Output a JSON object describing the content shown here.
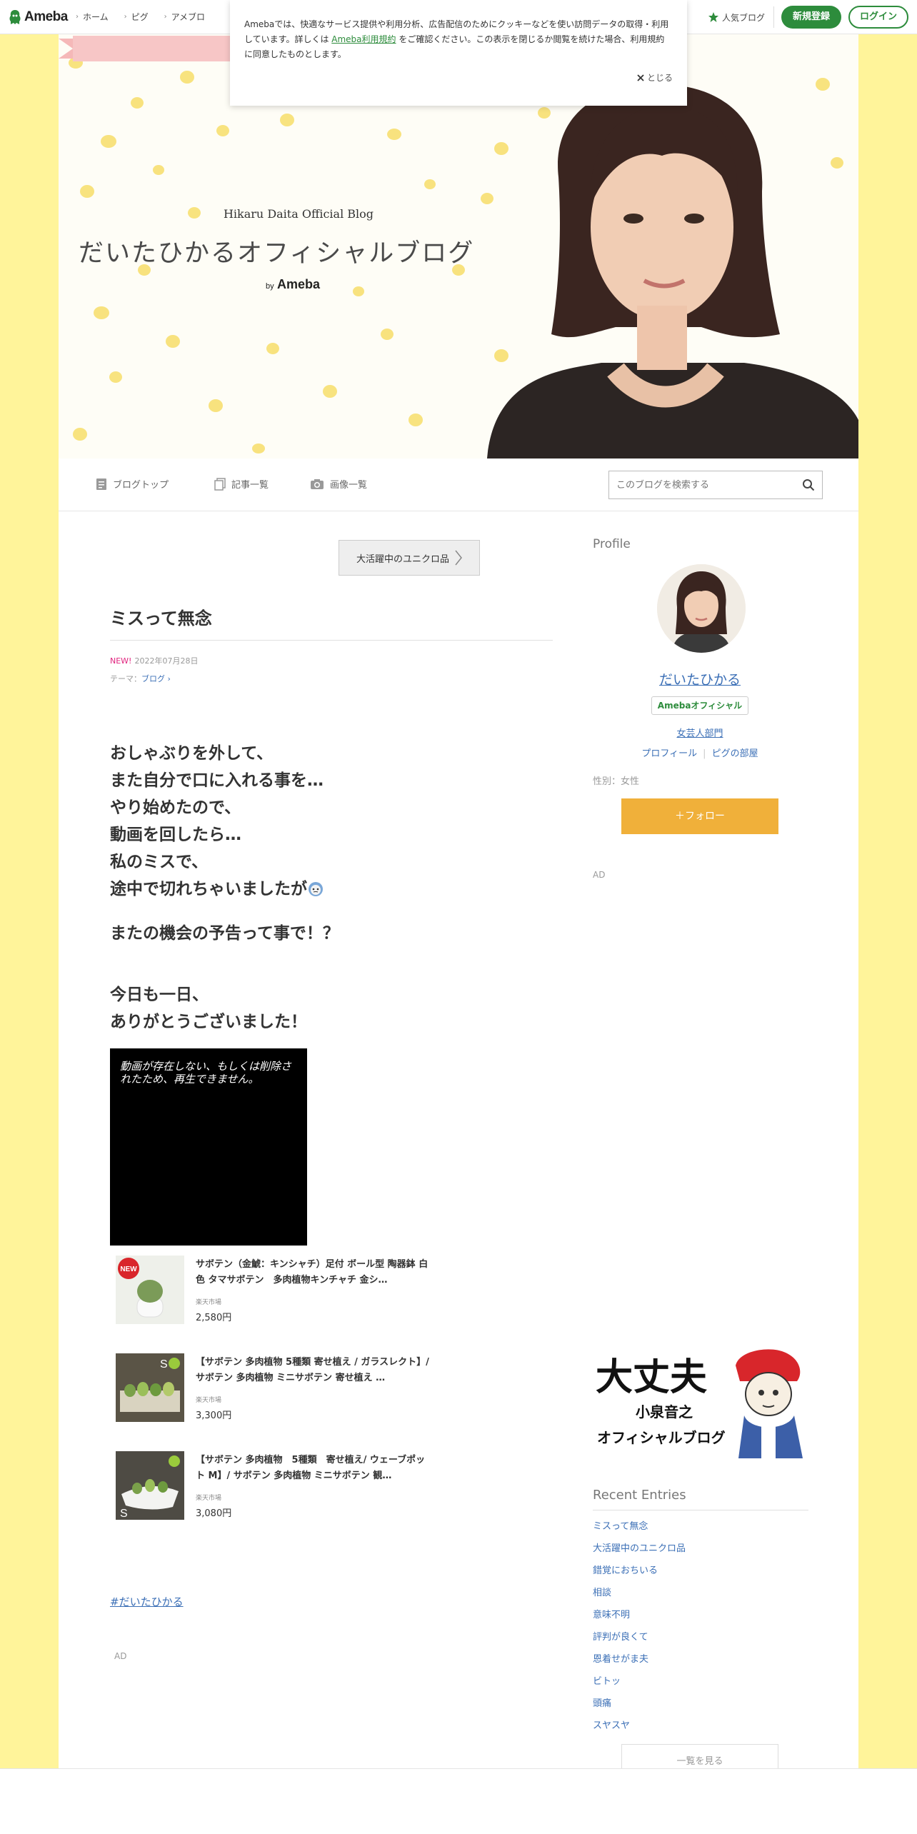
{
  "global_nav": {
    "logo": "Ameba",
    "items": [
      "ホーム",
      "ピグ",
      "アメブロ"
    ],
    "popular_label": "人気ブログ",
    "signup_label": "新規登録",
    "login_label": "ログイン"
  },
  "cookie": {
    "text_before": "Amebaでは、快適なサービス提供や利用分析、広告配信のためにクッキーなどを使い訪問データの取得・利用しています。詳しくは ",
    "link": "Ameba利用規約",
    "text_after": " をご確認ください。この表示を閉じるか閲覧を続けた場合、利用規約に同意したものとします。",
    "close_label": "とじる"
  },
  "header": {
    "ribbon": "Hikaru Daita Official Blog",
    "title": "だいたひかるオフィシャルブログ",
    "by": "by",
    "ameba": "Ameba"
  },
  "blog_nav": {
    "top": "ブログトップ",
    "entries": "記事一覧",
    "images": "画像一覧",
    "search_placeholder": "このブログを検索する"
  },
  "article": {
    "prev_label": "大活躍中のユニクロ品",
    "title": "ミスって無念",
    "new_badge": "NEW!",
    "date": "2022年07月28日",
    "theme_prefix": "テーマ：",
    "theme": "ブログ",
    "body_lines": [
      "おしゃぶりを外して、",
      "また自分で口に入れる事を…",
      "やり始めたので、",
      "動画を回したら…",
      "私のミスで、",
      "途中で切れちゃいましたが"
    ],
    "body_line2": "またの機会の予告って事で！？",
    "body_line3a": "今日も一日、",
    "body_line3b": "ありがとうございました！",
    "video_message": "動画が存在しない、もしくは削除されたため、再生できません。",
    "products": [
      {
        "name": "サボテン（金鯱：キンシャチ）足付 ボール型 陶器鉢 白色 タマサボテン　多肉植物キンチャチ 金シ…",
        "shop": "楽天市場",
        "price": "2,580円",
        "badge": "NEW"
      },
      {
        "name": "【サボテン 多肉植物 5種類 寄せ植え / ガラスレクト】/ サボテン 多肉植物 ミニサボテン 寄せ植え …",
        "shop": "楽天市場",
        "price": "3,300円",
        "badge": "S"
      },
      {
        "name": "【サボテン 多肉植物　5種類　寄せ植え/ ウェーブポット M】/ サボテン 多肉植物 ミニサボテン 観…",
        "shop": "楽天市場",
        "price": "3,080円",
        "badge": "S"
      }
    ],
    "hashtag": "#だいたひかる",
    "ad_label": "AD"
  },
  "sidebar": {
    "profile_heading": "Profile",
    "name": "だいたひかる",
    "official_badge": "Amebaオフィシャル",
    "category": "女芸人部門",
    "profile_link": "プロフィール",
    "pigg_link": "ピグの部屋",
    "gender": "性別：女性",
    "follow_label": "＋フォロー",
    "ad_label": "AD",
    "banner": {
      "line1": "大丈夫",
      "line2": "小泉音之",
      "line3": "オフィシャルブログ"
    },
    "recent_heading": "Recent Entries",
    "recent": [
      "ミスって無念",
      "大活躍中のユニクロ品",
      "錯覚におちいる",
      "相談",
      "意味不明",
      "評判が良くて",
      "恩着せがま夫",
      "ビトッ",
      "頭痛",
      "スヤスヤ"
    ],
    "more_label": "一覧を見る"
  },
  "colors": {
    "green": "#2d8c3c",
    "link": "#3b6fb6",
    "follow": "#f0b03a",
    "page_bg": "#fff49a",
    "new_badge": "#e1237e"
  }
}
